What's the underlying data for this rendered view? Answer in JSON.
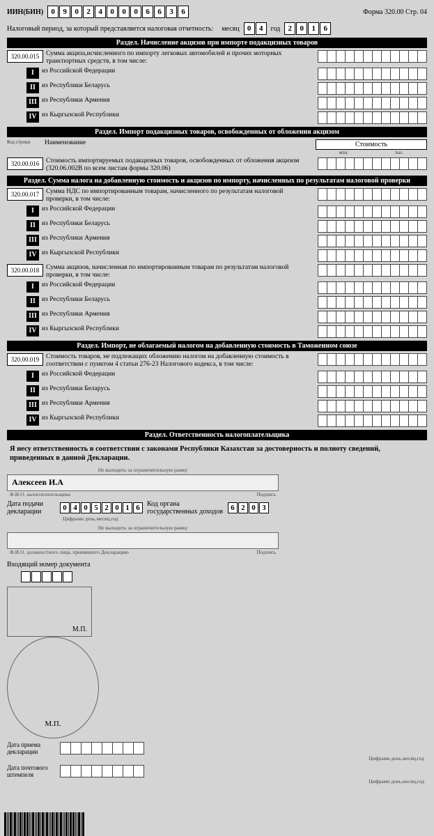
{
  "form_ref": "Форма 320.00 Стр. 04",
  "iin_label": "ИИН(БИН)",
  "iin": [
    "0",
    "9",
    "0",
    "2",
    "4",
    "0",
    "0",
    "0",
    "6",
    "6",
    "3",
    "6"
  ],
  "period_label": "Налоговый период, за который представляется налоговая отчетность:",
  "month_label": "месяц",
  "month": [
    "0",
    "4"
  ],
  "year_label": "год",
  "year": [
    "2",
    "0",
    "1",
    "6"
  ],
  "sec1": "Раздел. Начисление акцизов при импорте подакцизных товаров",
  "codes": {
    "c015": "320.00.015",
    "c016": "320.00.016",
    "c017": "320.00.017",
    "c018": "320.00.018",
    "c019": "320.00.019"
  },
  "d015": "Сумма акциза,исчисленного по импорту легковых автомобилей и прочих моторных транспортных средств, в том числе:",
  "r1": "из Российской Федерации",
  "r2": "из Республики Беларусь",
  "r3": "из Республики Армения",
  "r4": "из Кыргызской Республики",
  "sec2": "Раздел. Импорт подакцизных товаров, освобожденных от обложения акцизом",
  "kod": "Код строки",
  "name": "Наименование",
  "cost": "Стоимость",
  "mln": "млн.",
  "tys": "тыс.",
  "d016": "Стоимость импортируемых подакцизных товаров, освобожденных от обложения акцизом (320.06.002B по всем листам формы 320.06)",
  "sec3": "Раздел. Сумма налога на добавленную стоимость и акцизов по импорту, начисленных по результатам налоговой проверки",
  "d017": "Сумма НДС по импортированным товарам, начисленного по результатам налоговой проверки, в том числе:",
  "d018": "Сумма акцизов, начисленная по импортированным товарам по результатам налоговой проверки, в том числе:",
  "sec4": "Раздел. Импорт, не облагаемый налогом на добавленную стоимость в Таможенном союзе",
  "d019": "Стоимость товаров, не подлежащих обложению налогом на добавленную стоимость в соответствии с пунктом 4 статьи 276-23 Налогового кодекса, в том числе:",
  "sec5": "Раздел. Ответственность налогоплательщика",
  "declare": "Я несу ответственность в соответствии с законами Республики Казахстан за достоверность и  полноту сведений, приведенных в данной Декларации.",
  "sig_name": "Алексеев И.А",
  "noframe": "Не выходить за ограничительную рамку",
  "fio1": "Ф.И.О. налогоплательщика",
  "sign": "Подпись",
  "date_lbl": "Дата подачи декларации",
  "date": [
    "0",
    "4",
    "0",
    "5",
    "2",
    "0",
    "1",
    "6"
  ],
  "date_cap": "Цифрами день,месяц,год",
  "org_lbl": "Код органа государственных доходов",
  "org": [
    "6",
    "2",
    "0",
    "3"
  ],
  "fio2": "Ф.И.О. должностного лица, принявшего Декларацию",
  "incoming": "Входящий номер документа",
  "mp": "М.П.",
  "mp2": "М.П.",
  "recv_lbl": "Дата приема декларации",
  "stamp_lbl": "Дата почтового штемпеля",
  "roman": {
    "I": "I",
    "II": "II",
    "III": "III",
    "IV": "IV"
  }
}
